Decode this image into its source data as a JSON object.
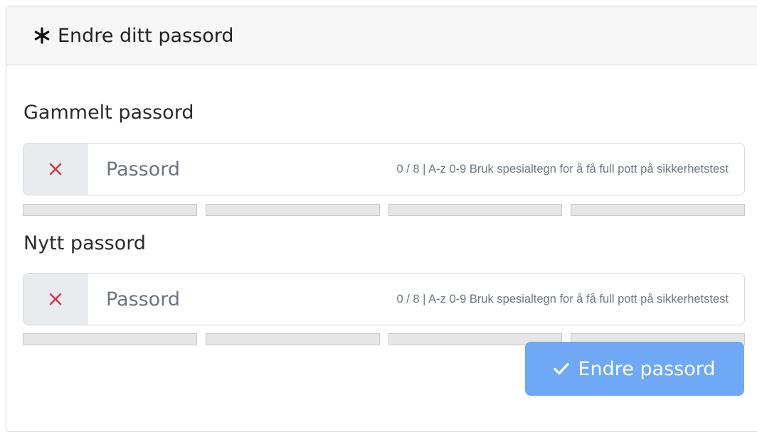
{
  "header": {
    "title": "Endre ditt passord",
    "icon": "asterisk-icon"
  },
  "fields": [
    {
      "label": "Gammelt passord",
      "placeholder": "Passord",
      "value": "",
      "status_icon": "x-icon",
      "hint": "0 / 8 | A-z 0-9 Bruk spesialtegn for å få full pott på sikkerhetstest",
      "strength_level": 0
    },
    {
      "label": "Nytt passord",
      "placeholder": "Passord",
      "value": "",
      "status_icon": "x-icon",
      "hint": "0 / 8 | A-z 0-9 Bruk spesialtegn for å få full pott på sikkerhetstest",
      "strength_level": 0
    }
  ],
  "submit": {
    "label": "Endre passord",
    "icon": "check-icon"
  },
  "colors": {
    "primary_button": "#6fa8f5",
    "error_icon": "#dc3545",
    "meter_empty": "#e6e6e6"
  }
}
